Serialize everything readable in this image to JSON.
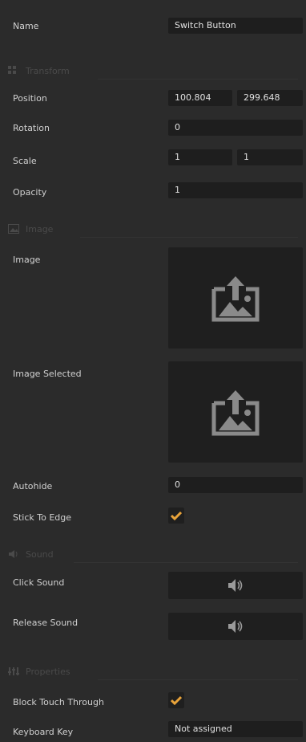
{
  "name": {
    "label": "Name",
    "value": "Switch Button"
  },
  "sections": {
    "transform": "Transform",
    "image": "Image",
    "sound": "Sound",
    "properties": "Properties"
  },
  "transform": {
    "position_label": "Position",
    "position_x": "100.804",
    "position_y": "299.648",
    "rotation_label": "Rotation",
    "rotation": "0",
    "scale_label": "Scale",
    "scale_x": "1",
    "scale_y": "1",
    "opacity_label": "Opacity",
    "opacity": "1"
  },
  "image": {
    "image_label": "Image",
    "image_selected_label": "Image Selected",
    "autohide_label": "Autohide",
    "autohide": "0",
    "stick_label": "Stick To Edge",
    "stick_checked": true
  },
  "sound": {
    "click_label": "Click Sound",
    "release_label": "Release Sound"
  },
  "properties": {
    "block_label": "Block Touch Through",
    "block_checked": true,
    "keyboard_label": "Keyboard Key",
    "keyboard_value": "Not assigned"
  },
  "colors": {
    "background": "#2b2b2b",
    "field": "#1e1e1e",
    "check": "#e8a33a",
    "icon": "#8a8a8a"
  }
}
